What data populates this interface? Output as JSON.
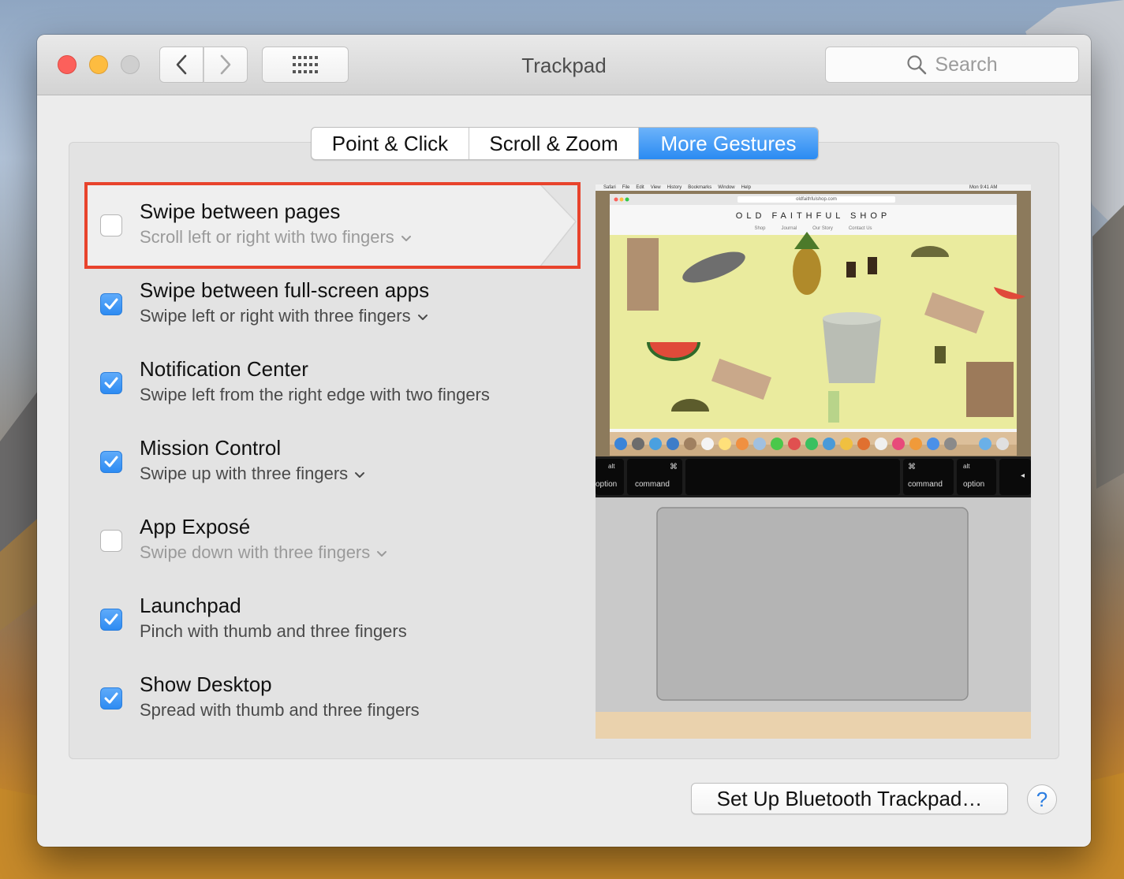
{
  "window": {
    "title": "Trackpad"
  },
  "search": {
    "placeholder": "Search"
  },
  "tabs": [
    {
      "label": "Point & Click",
      "selected": false
    },
    {
      "label": "Scroll & Zoom",
      "selected": false
    },
    {
      "label": "More Gestures",
      "selected": true
    }
  ],
  "gestures": [
    {
      "title": "Swipe between pages",
      "subtitle": "Scroll left or right with two fingers",
      "checked": false,
      "has_dropdown": true,
      "highlighted": true
    },
    {
      "title": "Swipe between full-screen apps",
      "subtitle": "Swipe left or right with three fingers",
      "checked": true,
      "has_dropdown": true
    },
    {
      "title": "Notification Center",
      "subtitle": "Swipe left from the right edge with two fingers",
      "checked": true,
      "has_dropdown": false
    },
    {
      "title": "Mission Control",
      "subtitle": "Swipe up with three fingers",
      "checked": true,
      "has_dropdown": true
    },
    {
      "title": "App Exposé",
      "subtitle": "Swipe down with three fingers",
      "checked": false,
      "has_dropdown": true
    },
    {
      "title": "Launchpad",
      "subtitle": "Pinch with thumb and three fingers",
      "checked": true,
      "has_dropdown": false
    },
    {
      "title": "Show Desktop",
      "subtitle": "Spread with thumb and three fingers",
      "checked": true,
      "has_dropdown": false
    }
  ],
  "preview": {
    "menubar": [
      "Safari",
      "File",
      "Edit",
      "View",
      "History",
      "Bookmarks",
      "Window",
      "Help"
    ],
    "clock": "Mon 9:41 AM",
    "url": "oldfaithfulshop.com",
    "shop_name": "OLD FAITHFUL SHOP",
    "shop_nav": [
      "Shop",
      "Journal",
      "Our Story",
      "Contact Us"
    ],
    "keys": [
      {
        "top": "alt",
        "bottom": "option"
      },
      {
        "top": "⌘",
        "bottom": "command"
      },
      {
        "top": "",
        "bottom": ""
      },
      {
        "top": "⌘",
        "bottom": "command"
      },
      {
        "top": "alt",
        "bottom": "option"
      },
      {
        "top": "◂",
        "bottom": ""
      }
    ]
  },
  "buttons": {
    "setup": "Set Up Bluetooth Trackpad…",
    "help": "?"
  },
  "colors": {
    "accent": "#2d8bf2",
    "highlight": "#e8432c",
    "preview_bg": "#eaeb9e"
  }
}
